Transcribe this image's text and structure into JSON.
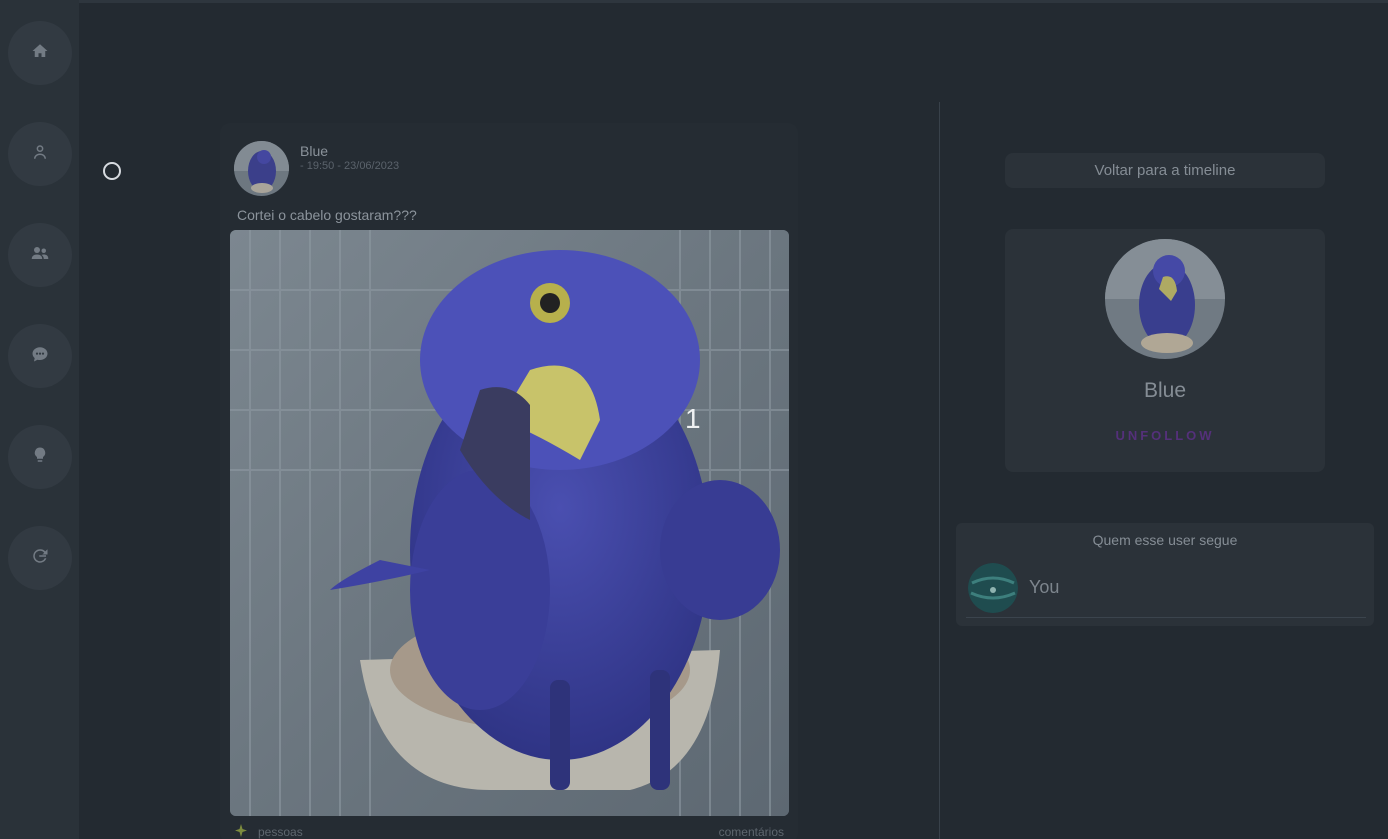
{
  "sidebar": {
    "items": [
      {
        "icon": "home-icon"
      },
      {
        "icon": "user-icon"
      },
      {
        "icon": "users-icon"
      },
      {
        "icon": "chat-icon"
      },
      {
        "icon": "lightbulb-icon"
      },
      {
        "icon": "logout-icon"
      }
    ]
  },
  "post": {
    "author": "Blue",
    "date": "- 19:50 - 23/06/2023",
    "text": "Cortei o cabelo gostaram???",
    "overlay_number": "1",
    "reactions_label": "pessoas",
    "comments_label": "comentários"
  },
  "right": {
    "back_button": "Voltar para a timeline",
    "profile": {
      "name": "Blue",
      "unfollow_label": "UNFOLLOW"
    },
    "following": {
      "title": "Quem esse user segue",
      "users": [
        {
          "name": "You"
        }
      ]
    }
  },
  "colors": {
    "background": "#232a31",
    "sidebar": "#2a3239",
    "card": "#2b3239",
    "accent_unfollow": "#54307a"
  }
}
